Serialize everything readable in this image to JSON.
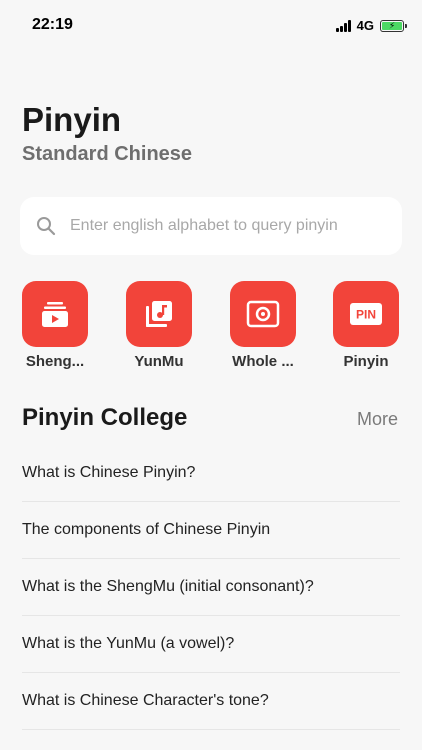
{
  "status_bar": {
    "time": "22:19",
    "network": "4G",
    "battery_color": "#4cd964"
  },
  "header": {
    "title": "Pinyin",
    "subtitle": "Standard Chinese"
  },
  "search": {
    "placeholder": "Enter english alphabet to query pinyin",
    "value": ""
  },
  "shortcuts": [
    {
      "label": "Sheng...",
      "icon": "video-stack-icon"
    },
    {
      "label": "YunMu",
      "icon": "music-library-icon"
    },
    {
      "label": "Whole ...",
      "icon": "radio-record-icon"
    },
    {
      "label": "Pinyin",
      "icon": "pin-badge-icon"
    }
  ],
  "college": {
    "title": "Pinyin College",
    "more_label": "More",
    "articles": [
      "What is Chinese Pinyin?",
      "The components of Chinese Pinyin",
      "What is the ShengMu (initial consonant)?",
      "What is the YunMu (a vowel)?",
      "What is Chinese Character's tone?"
    ]
  },
  "colors": {
    "accent": "#f2443a",
    "background": "#f7f7f7"
  }
}
